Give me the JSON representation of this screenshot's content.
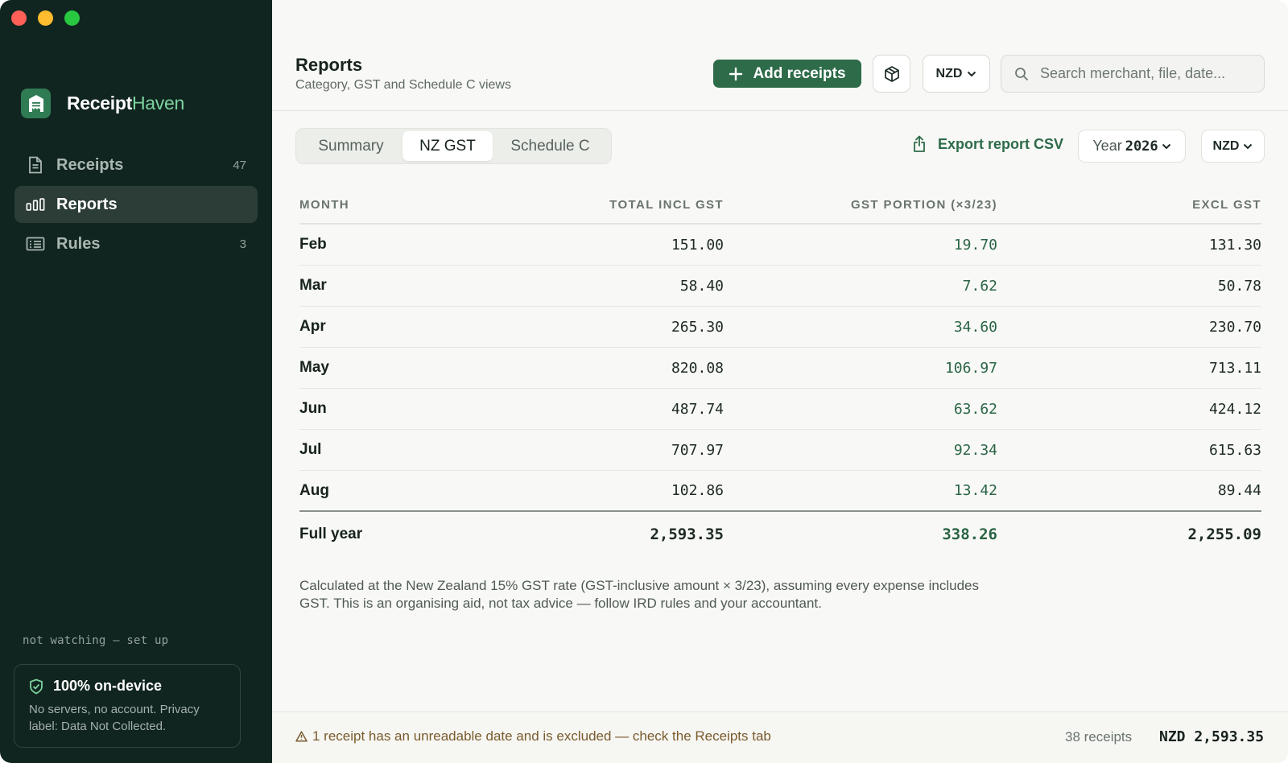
{
  "app": {
    "brand_part1": "Receipt",
    "brand_part2": "Haven",
    "accent": "#2d6b49"
  },
  "sidebar": {
    "items": [
      {
        "label": "Receipts",
        "count": "47",
        "icon": "document-icon"
      },
      {
        "label": "Reports",
        "count": "",
        "icon": "bar-chart-icon"
      },
      {
        "label": "Rules",
        "count": "3",
        "icon": "list-icon"
      }
    ],
    "watch_status": "not watching — set up",
    "privacy": {
      "title": "100% on-device",
      "text": "No servers, no account. Privacy label: Data Not Collected."
    }
  },
  "header": {
    "title": "Reports",
    "subtitle": "Category, GST and Schedule C views",
    "add_label": "Add receipts",
    "currency": "NZD",
    "search_placeholder": "Search merchant, file, date..."
  },
  "tabs": [
    "Summary",
    "NZ GST",
    "Schedule C"
  ],
  "toolbar": {
    "export_label": "Export report CSV",
    "year_label": "Year",
    "year_value": "2026",
    "currency": "NZD"
  },
  "table": {
    "columns": [
      "MONTH",
      "TOTAL INCL GST",
      "GST PORTION (×3/23)",
      "EXCL GST"
    ],
    "rows": [
      {
        "month": "Feb",
        "total": "151.00",
        "gst": "19.70",
        "excl": "131.30"
      },
      {
        "month": "Mar",
        "total": "58.40",
        "gst": "7.62",
        "excl": "50.78"
      },
      {
        "month": "Apr",
        "total": "265.30",
        "gst": "34.60",
        "excl": "230.70"
      },
      {
        "month": "May",
        "total": "820.08",
        "gst": "106.97",
        "excl": "713.11"
      },
      {
        "month": "Jun",
        "total": "487.74",
        "gst": "63.62",
        "excl": "424.12"
      },
      {
        "month": "Jul",
        "total": "707.97",
        "gst": "92.34",
        "excl": "615.63"
      },
      {
        "month": "Aug",
        "total": "102.86",
        "gst": "13.42",
        "excl": "89.44"
      }
    ],
    "totals": {
      "month": "Full year",
      "total": "2,593.35",
      "gst": "338.26",
      "excl": "2,255.09"
    }
  },
  "note": "Calculated at the New Zealand 15% GST rate (GST-inclusive amount × 3/23), assuming every expense includes GST. This is an organising aid, not tax advice — follow IRD rules and your accountant.",
  "status": {
    "warning": "1 receipt has an unreadable date and is excluded — check the Receipts tab",
    "count": "38 receipts",
    "total": "NZD 2,593.35"
  }
}
